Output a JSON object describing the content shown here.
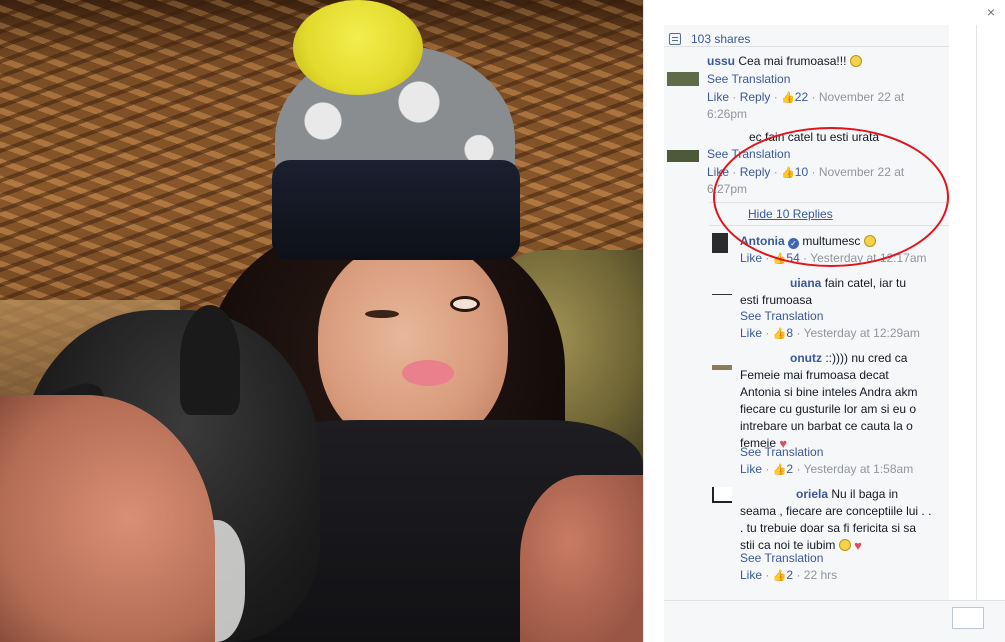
{
  "panel": {
    "close_label": "×",
    "shares": "103 shares"
  },
  "comments": [
    {
      "name": "ussu",
      "text": "Cea mai frumoasa!!!",
      "see_translation": "See Translation",
      "like": "Like",
      "reply": "Reply",
      "likes": "22",
      "time_line1": "November 22 at",
      "time_line2": "6:26pm"
    },
    {
      "name": "",
      "prefix": "ec",
      "text": "fain catel tu esti urata",
      "see_translation": "See Translation",
      "like": "Like",
      "reply": "Reply",
      "likes": "10",
      "time_line1": "November 22 at",
      "time_line2": "6:27pm",
      "hide_replies": "Hide 10 Replies"
    }
  ],
  "replies": [
    {
      "name": "Antonia",
      "text": "multumesc",
      "like": "Like",
      "likes": "54",
      "time": "Yesterday at 12:17am"
    },
    {
      "name": "uiana",
      "text_line1": "fain catel, iar tu",
      "text_line2": "esti frumoasa",
      "see_translation": "See Translation",
      "like": "Like",
      "likes": "8",
      "time": "Yesterday at 12:29am"
    },
    {
      "name": "onutz",
      "text_lines": [
        "::)))) nu cred ca",
        "Femeie mai frumoasa decat",
        "Antonia si bine inteles Andra akm",
        "fiecare cu gusturile lor am si eu o",
        "intrebare un barbat ce cauta la o",
        "femeie"
      ],
      "see_translation": "See Translation",
      "like": "Like",
      "likes": "2",
      "time": "Yesterday at 1:58am"
    },
    {
      "name": "oriela",
      "text_lines": [
        "Nu il baga in",
        "seama , fiecare are conceptiile lui . .",
        ". tu trebuie doar sa fi fericita si sa",
        "stii ca noi te iubim"
      ],
      "see_translation": "See Translation",
      "like": "Like",
      "likes": "2",
      "time": "22 hrs"
    }
  ],
  "separator": "·"
}
